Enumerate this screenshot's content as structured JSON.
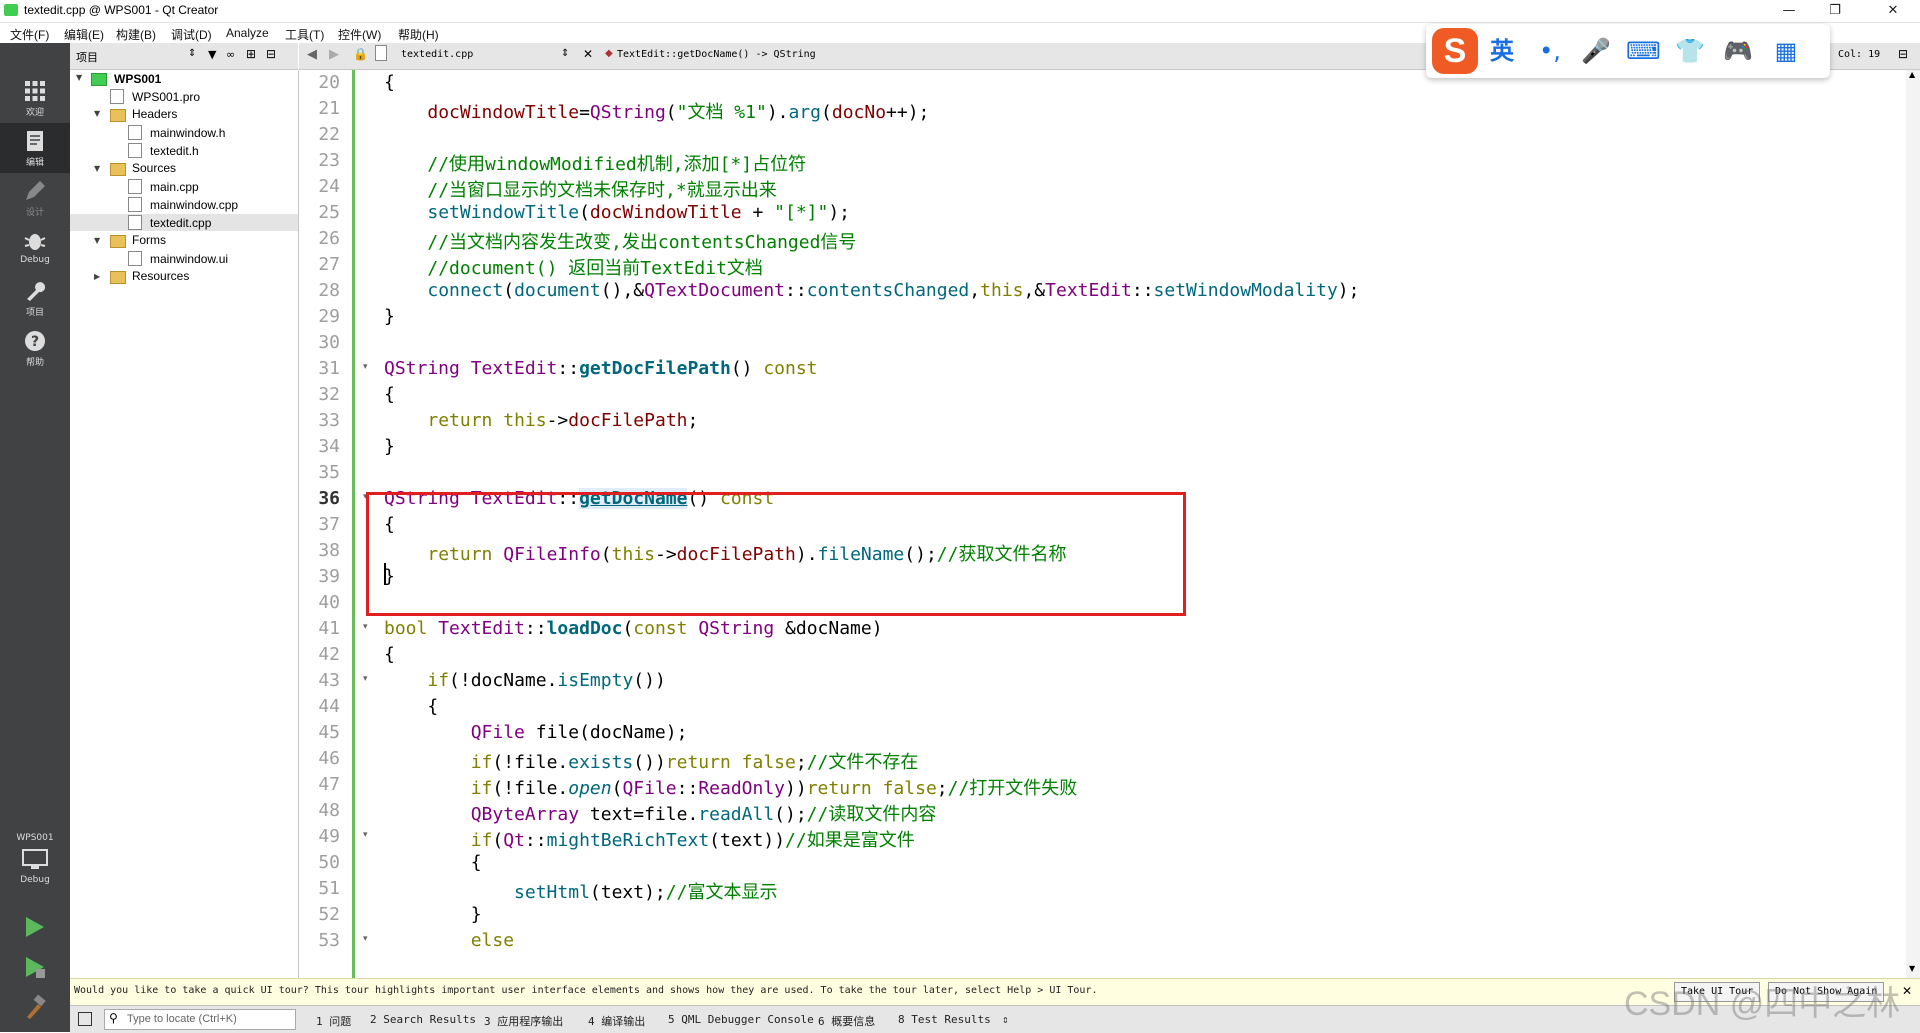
{
  "window": {
    "title": "textedit.cpp @ WPS001 - Qt Creator",
    "minimize": "—",
    "maximize": "❐",
    "close": "✕"
  },
  "menu": [
    "文件(F)",
    "编辑(E)",
    "构建(B)",
    "调试(D)",
    "Analyze",
    "工具(T)",
    "控件(W)",
    "帮助(H)"
  ],
  "modes": [
    {
      "label": "欢迎",
      "icon": "grid-icon"
    },
    {
      "label": "编辑",
      "icon": "edit-icon"
    },
    {
      "label": "设计",
      "icon": "pencil-icon"
    },
    {
      "label": "Debug",
      "icon": "bug-icon"
    },
    {
      "label": "项目",
      "icon": "wrench-icon"
    },
    {
      "label": "帮助",
      "icon": "help-icon"
    }
  ],
  "kit": {
    "name": "WPS001",
    "label": "Debug"
  },
  "project_panel": {
    "title": "项目",
    "tree": [
      {
        "label": "WPS001",
        "level": 0,
        "type": "project",
        "expanded": true
      },
      {
        "label": "WPS001.pro",
        "level": 1,
        "type": "file"
      },
      {
        "label": "Headers",
        "level": 1,
        "type": "folder",
        "expanded": true
      },
      {
        "label": "mainwindow.h",
        "level": 2,
        "type": "file"
      },
      {
        "label": "textedit.h",
        "level": 2,
        "type": "file"
      },
      {
        "label": "Sources",
        "level": 1,
        "type": "folder",
        "expanded": true
      },
      {
        "label": "main.cpp",
        "level": 2,
        "type": "file"
      },
      {
        "label": "mainwindow.cpp",
        "level": 2,
        "type": "file"
      },
      {
        "label": "textedit.cpp",
        "level": 2,
        "type": "file",
        "selected": true
      },
      {
        "label": "Forms",
        "level": 1,
        "type": "folder",
        "expanded": true
      },
      {
        "label": "mainwindow.ui",
        "level": 2,
        "type": "file"
      },
      {
        "label": "Resources",
        "level": 1,
        "type": "folder",
        "expanded": false
      }
    ]
  },
  "editor_toolbar": {
    "file": "textedit.cpp",
    "symbol": "TextEdit::getDocName() -> QString",
    "cursor": "Col: 19"
  },
  "editor": {
    "current_line": 36,
    "line_numbers": [
      "20",
      "21",
      "22",
      "23",
      "24",
      "25",
      "26",
      "27",
      "28",
      "29",
      "30",
      "31",
      "32",
      "33",
      "34",
      "35",
      "36",
      "37",
      "38",
      "39",
      "40",
      "41",
      "42",
      "43",
      "44",
      "45",
      "46",
      "47",
      "48",
      "49",
      "50",
      "51",
      "52",
      "53"
    ],
    "fold_markers": [
      "31",
      "36",
      "41",
      "43",
      "49",
      "53"
    ]
  },
  "ime": {
    "logo": "S",
    "lang": "英",
    "punct": "•,",
    "mic": "🎤",
    "keyboard": "⌨",
    "skin": "👕",
    "game": "🎮",
    "apps": "▦"
  },
  "infobar": {
    "text": "Would you like to take a quick UI tour? This tour highlights important user interface elements and shows how they are used. To take the tour later, select Help > UI Tour.",
    "take_tour": "Take UI Tour",
    "dont_show": "Do Not Show Again",
    "close": "✕"
  },
  "output_bar": {
    "locate_placeholder": "Type to locate (Ctrl+K)",
    "panes": [
      "1 问题",
      "2 Search Results",
      "3 应用程序输出",
      "4 编译输出",
      "5 QML Debugger Console",
      "6 概要信息",
      "8 Test Results"
    ]
  },
  "watermark": "CSDN @四中之林"
}
